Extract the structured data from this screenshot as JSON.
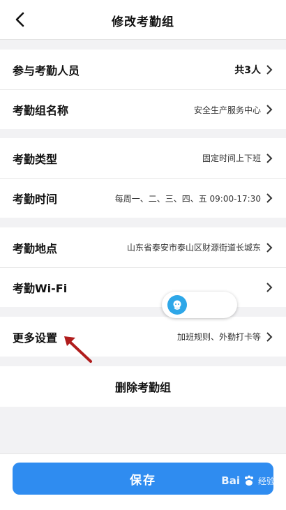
{
  "header": {
    "title": "修改考勤组"
  },
  "groups": [
    {
      "rows": [
        {
          "label": "参与考勤人员",
          "value": "共3人"
        },
        {
          "label": "考勤组名称",
          "value": "安全生产服务中心"
        }
      ]
    },
    {
      "rows": [
        {
          "label": "考勤类型",
          "value": "固定时间上下班"
        },
        {
          "label": "考勤时间",
          "value": "每周一、二、三、四、五 09:00-17:30"
        }
      ]
    },
    {
      "rows": [
        {
          "label": "考勤地点",
          "value": "山东省泰安市泰山区财源街道长城东"
        },
        {
          "label": "考勤Wi-Fi",
          "value": ""
        }
      ]
    },
    {
      "rows": [
        {
          "label": "更多设置",
          "value": "加班规则、外勤打卡等"
        }
      ]
    }
  ],
  "actions": {
    "delete_label": "删除考勤组",
    "save_label": "保存"
  },
  "watermark": {
    "brand": "Bai",
    "brand_suffix": "经验"
  },
  "colors": {
    "primary": "#2f8cf0",
    "background": "#f2f2f4",
    "annotation_arrow": "#b01c1c"
  },
  "icons": {
    "back": "chevron-left-icon",
    "row_arrow": "chevron-right-icon",
    "assistant": "assistant-bubble-icon"
  }
}
